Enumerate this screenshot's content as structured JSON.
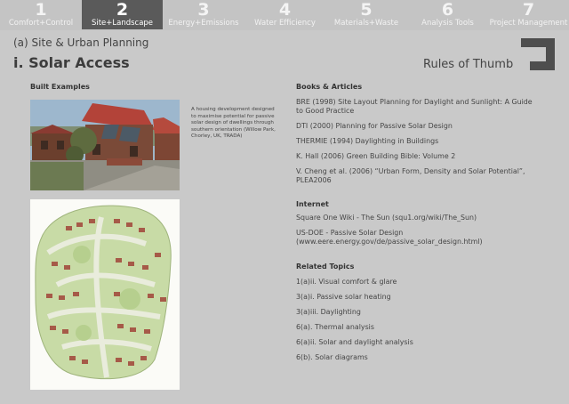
{
  "nav": {
    "tabs": [
      {
        "num": "1",
        "label": "Comfort+Control"
      },
      {
        "num": "2",
        "label": "Site+Landscape"
      },
      {
        "num": "3",
        "label": "Energy+Emissions"
      },
      {
        "num": "4",
        "label": "Water Efficiency"
      },
      {
        "num": "5",
        "label": "Materials+Waste"
      },
      {
        "num": "6",
        "label": "Analysis Tools"
      },
      {
        "num": "7",
        "label": "Project Management"
      }
    ],
    "active_index": 1
  },
  "page": {
    "breadcrumb": "(a) Site & Urban Planning",
    "title": "i. Solar Access",
    "rules_of_thumb": "Rules of Thumb"
  },
  "examples": {
    "heading": "Built Examples",
    "caption": "A housing development designed to maximise potential for passive solar design of dwellings through southern orientation (Willow Park, Chorley, UK, TRADA)"
  },
  "books": {
    "heading": "Books & Articles",
    "items": [
      "BRE (1998) Site Layout Planning for Daylight and Sunlight: A Guide to Good Practice",
      "DTI (2000) Planning for Passive Solar Design",
      "THERMIE (1994) Daylighting in Buildings",
      "K. Hall (2006) Green Building Bible: Volume 2",
      "V. Cheng et al. (2006) “Urban Form, Density and Solar Potential”, PLEA2006"
    ]
  },
  "internet": {
    "heading": "Internet",
    "items": [
      "Square One Wiki - The Sun (squ1.org/wiki/The_Sun)",
      "US-DOE - Passive Solar Design (www.eere.energy.gov/de/passive_solar_design.html)"
    ]
  },
  "related": {
    "heading": "Related Topics",
    "items": [
      "1(a)ii. Visual comfort & glare",
      "3(a)i. Passive solar heating",
      "3(a)iii. Daylighting",
      "6(a). Thermal analysis",
      "6(a)ii. Solar and daylight analysis",
      "6(b). Solar diagrams"
    ]
  },
  "colors": {
    "background": "#c9c9c9",
    "active_tab": "#5a5a5a",
    "tab_text": "#f4f4f4"
  }
}
